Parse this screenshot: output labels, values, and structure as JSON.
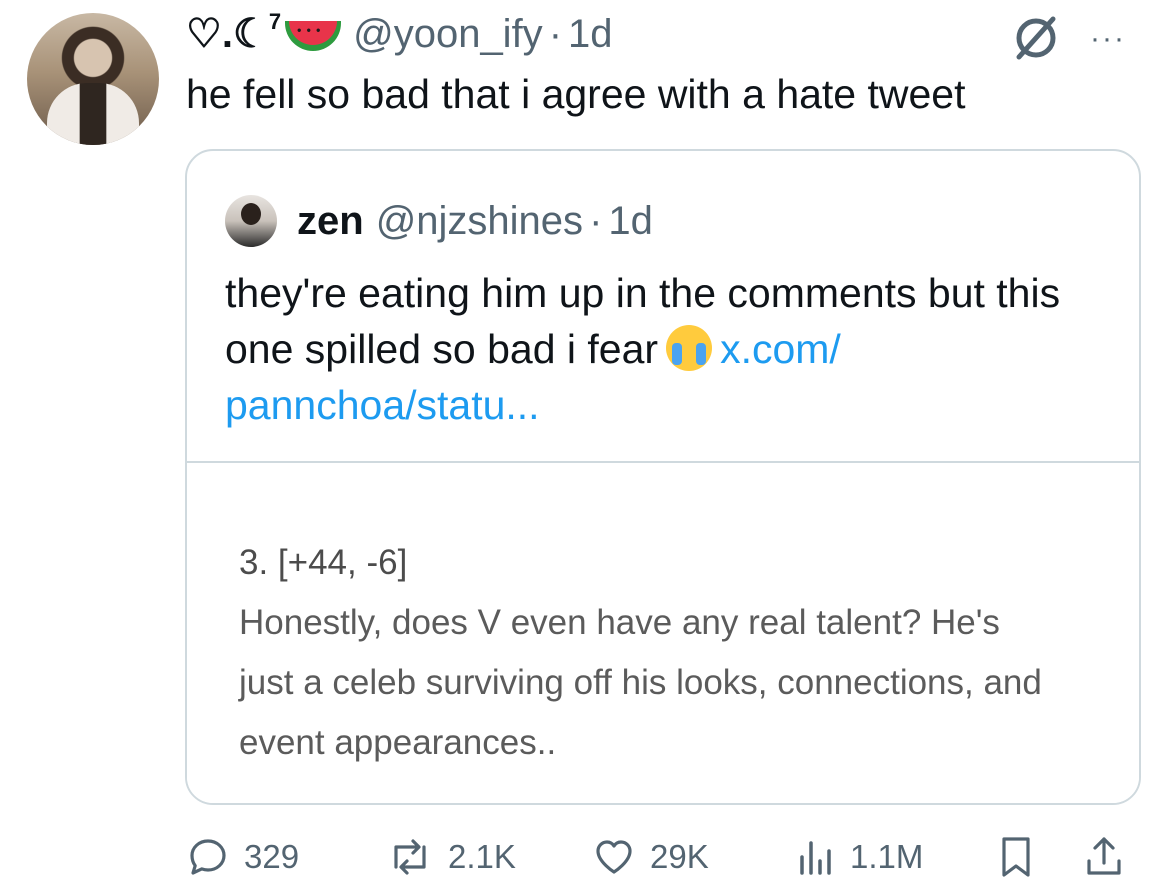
{
  "tweet": {
    "display_name_prefix": "♡.☾",
    "display_name_sup": "7",
    "handle": "@yoon_ify",
    "dot": "·",
    "time": "1d",
    "text": "he fell so bad that i agree with a hate tweet"
  },
  "quoted": {
    "name": "zen",
    "handle": "@njzshines",
    "dot": "·",
    "time": "1d",
    "text_before": "they're eating him up in the comments but this one spilled so bad i fear",
    "link_text": "x.com/ pannchoa/statu...",
    "image": {
      "comment_number": "3. [+44, -6]",
      "comment_text": "Honestly, does V even have any real talent? He's just a celeb surviving off his looks, connections, and event appearances.."
    }
  },
  "actions": {
    "replies": "329",
    "reposts": "2.1K",
    "likes": "29K",
    "views": "1.1M"
  },
  "icons": [
    "heart-outline-icon",
    "moon-icon",
    "watermelon-icon",
    "null-set-icon",
    "more-icon",
    "reply-icon",
    "repost-icon",
    "like-icon",
    "views-icon",
    "bookmark-icon",
    "share-icon",
    "crying-face-icon"
  ],
  "colors": {
    "link": "#1d9bf0",
    "secondary": "#536471",
    "border": "#cfd9de"
  }
}
